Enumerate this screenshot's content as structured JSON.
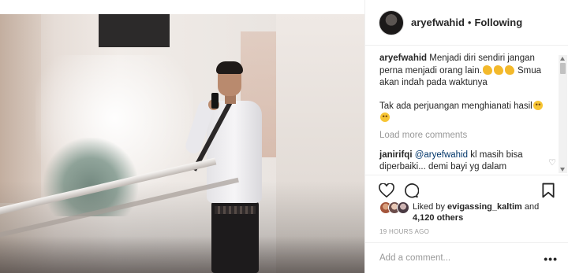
{
  "header": {
    "username": "aryefwahid",
    "separator": "•",
    "follow_status": "Following"
  },
  "caption": {
    "username": "aryefwahid",
    "text_1": "Menjadi diri sendiri jangan perna menjadi orang lain.",
    "text_2": "Smua akan indah pada waktunya",
    "text_3": "Tak ada perjuangan menghianati hasil",
    "emojis": [
      "flexed-biceps",
      "flexed-biceps",
      "flexed-biceps",
      "smiling-face",
      "smiling-face"
    ]
  },
  "load_more_label": "Load more comments",
  "comments": [
    {
      "username": "janirifqi",
      "mention": "@aryefwahid",
      "text": "kl masih bisa diperbaiki... demi bayi yg dalam kandungan.."
    }
  ],
  "actions": {
    "like_icon": "heart-icon",
    "comment_icon": "comment-icon",
    "save_icon": "bookmark-icon"
  },
  "likes": {
    "prefix": "Liked by",
    "liker": "evigassing_kaltim",
    "joiner": "and",
    "others": "4,120 others"
  },
  "timestamp": "19 HOURS AGO",
  "add_comment": {
    "placeholder": "Add a comment...",
    "more_label": "•••"
  },
  "colors": {
    "text": "#262626",
    "muted": "#999999",
    "border": "#efefef",
    "mention": "#003569"
  }
}
